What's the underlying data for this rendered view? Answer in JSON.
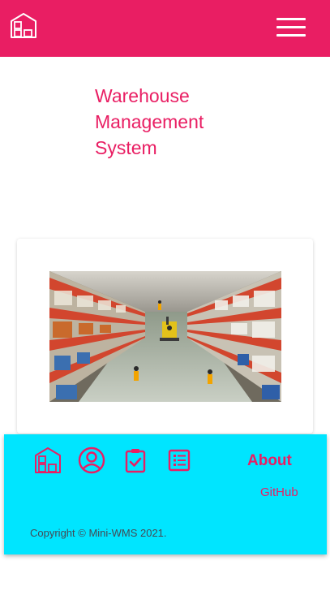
{
  "header": {
    "background": "#e91e63",
    "logo_icon": "warehouse-icon",
    "menu_icon": "hamburger-menu-icon"
  },
  "hero": {
    "title": "Warehouse Management System",
    "color": "#e91e63"
  },
  "card": {
    "image_subject": "warehouse-aisle-photo"
  },
  "footer": {
    "background": "#00e5ff",
    "icons": [
      "warehouse-icon",
      "user-circle-icon",
      "clipboard-check-icon",
      "list-icon"
    ],
    "about_label": "About",
    "github_label": "GitHub",
    "copyright": "Copyright © Mini-WMS 2021."
  }
}
